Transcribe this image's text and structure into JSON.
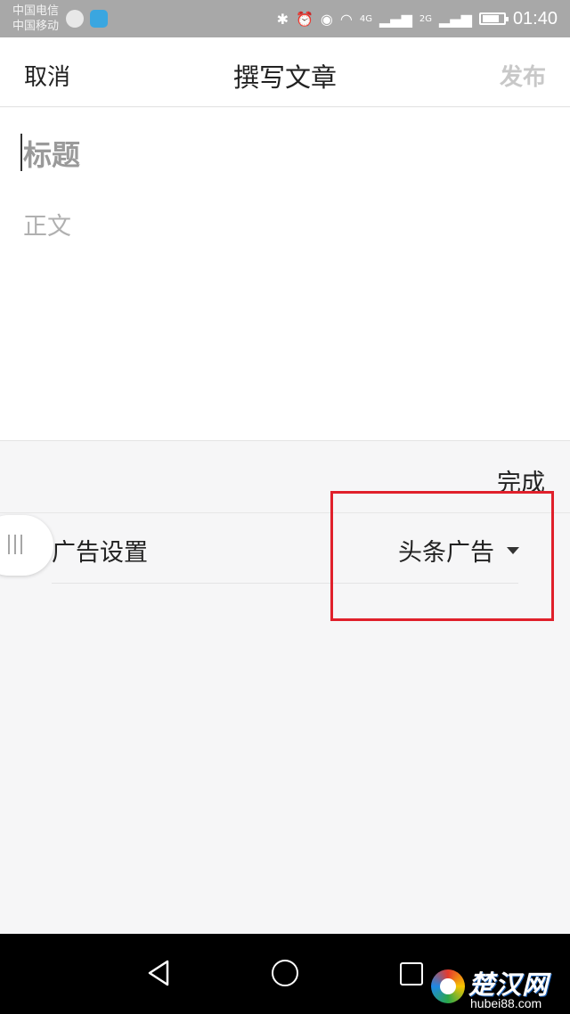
{
  "status_bar": {
    "carrier_1": "中国电信",
    "carrier_2": "中国移动",
    "net_4g": "4G",
    "net_2g": "2G",
    "time": "01:40"
  },
  "header": {
    "cancel_label": "取消",
    "title": "撰写文章",
    "publish_label": "发布"
  },
  "editor": {
    "title_placeholder": "标题",
    "body_placeholder": "正文"
  },
  "settings_panel": {
    "done_label": "完成",
    "ad_setting_label": "广告设置",
    "ad_setting_value": "头条广告"
  },
  "watermark": {
    "name": "楚汉网",
    "url": "hubei88.com"
  },
  "colors": {
    "status_bar_bg": "#a8a8a8",
    "publish_disabled": "#c8c8c8",
    "highlight_box": "#e0202b",
    "nav_bar_bg": "#000000"
  }
}
